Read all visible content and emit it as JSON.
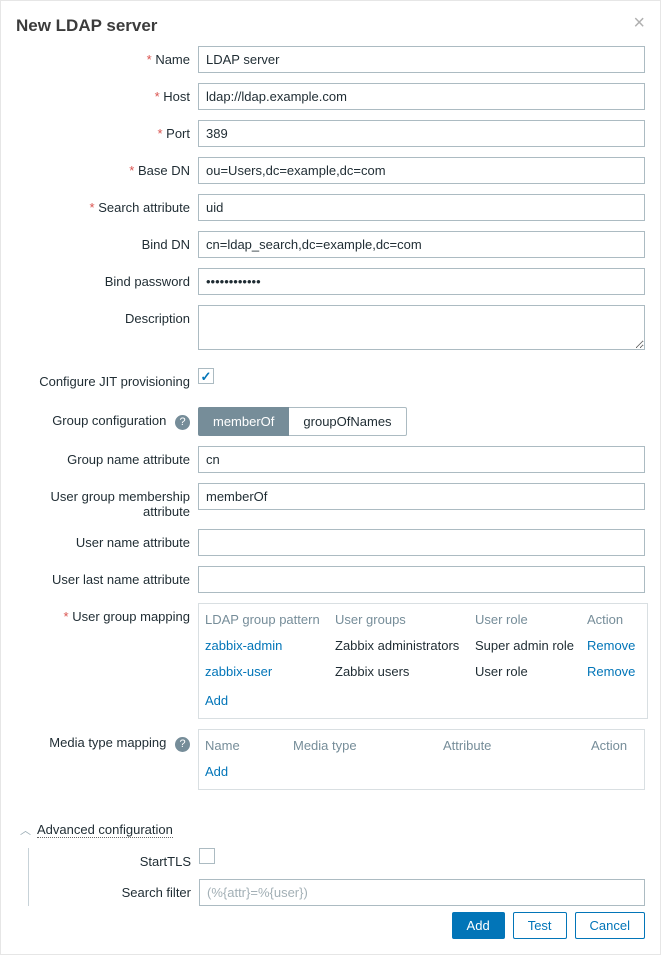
{
  "dialog": {
    "title": "New LDAP server"
  },
  "labels": {
    "name": "Name",
    "host": "Host",
    "port": "Port",
    "base_dn": "Base DN",
    "search_attribute": "Search attribute",
    "bind_dn": "Bind DN",
    "bind_password": "Bind password",
    "description": "Description",
    "jit": "Configure JIT provisioning",
    "group_config": "Group configuration",
    "group_name_attr": "Group name attribute",
    "user_group_membership_attr": "User group membership attribute",
    "user_name_attr": "User name attribute",
    "user_last_name_attr": "User last name attribute",
    "user_group_mapping": "User group mapping",
    "media_type_mapping": "Media type mapping",
    "advanced": "Advanced configuration",
    "starttls": "StartTLS",
    "search_filter": "Search filter"
  },
  "values": {
    "name": "LDAP server",
    "host": "ldap://ldap.example.com",
    "port": "389",
    "base_dn": "ou=Users,dc=example,dc=com",
    "search_attribute": "uid",
    "bind_dn": "cn=ldap_search,dc=example,dc=com",
    "bind_password": "••••••••••••",
    "group_name_attr": "cn",
    "user_group_membership_attr": "memberOf",
    "search_filter_placeholder": "(%{attr}=%{user})"
  },
  "group_config": {
    "option1": "memberOf",
    "option2": "groupOfNames"
  },
  "user_group_mapping": {
    "headers": {
      "pattern": "LDAP group pattern",
      "ugroups": "User groups",
      "urole": "User role",
      "action": "Action"
    },
    "rows": [
      {
        "pattern": "zabbix-admin",
        "ugroups": "Zabbix administrators",
        "urole": "Super admin role",
        "action": "Remove"
      },
      {
        "pattern": "zabbix-user",
        "ugroups": "Zabbix users",
        "urole": "User role",
        "action": "Remove"
      }
    ],
    "add": "Add"
  },
  "media_mapping": {
    "headers": {
      "name": "Name",
      "media_type": "Media type",
      "attribute": "Attribute",
      "action": "Action"
    },
    "add": "Add"
  },
  "footer": {
    "add": "Add",
    "test": "Test",
    "cancel": "Cancel"
  }
}
